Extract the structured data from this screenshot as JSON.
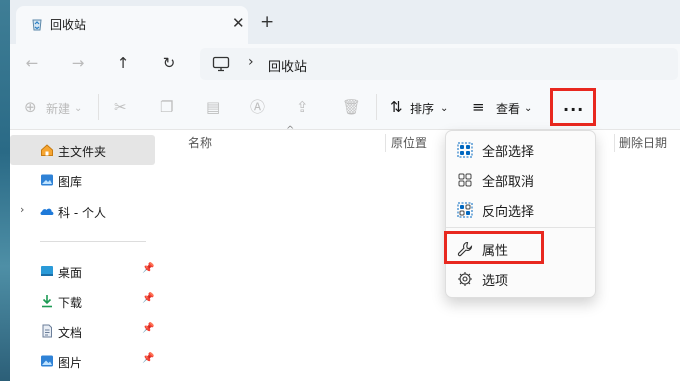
{
  "window": {
    "tab_title": "回收站",
    "tab_close": "✕",
    "new_tab": "+"
  },
  "nav": {
    "back": "←",
    "forward": "→",
    "up": "↑",
    "refresh": "↻"
  },
  "address": {
    "separator": "›",
    "location": "回收站"
  },
  "toolbar": {
    "new_label": "新建",
    "sort_label": "排序",
    "view_label": "查看",
    "more_label": "···"
  },
  "sidebar": {
    "items": [
      {
        "label": "主文件夹",
        "icon": "home-icon"
      },
      {
        "label": "图库",
        "icon": "gallery-icon"
      },
      {
        "label": "科 - 个人",
        "icon": "onedrive-icon"
      },
      {
        "label": "桌面",
        "icon": "desktop-icon"
      },
      {
        "label": "下载",
        "icon": "download-icon"
      },
      {
        "label": "文档",
        "icon": "document-icon"
      },
      {
        "label": "图片",
        "icon": "pictures-icon"
      }
    ],
    "pin_glyph": "📌",
    "expand_glyph": "›"
  },
  "columns": {
    "name": "名称",
    "original_location": "原位置",
    "date_deleted": "删除日期",
    "sort_indicator": "^"
  },
  "menu": {
    "items": [
      {
        "label": "全部选择",
        "icon": "select-all-icon"
      },
      {
        "label": "全部取消",
        "icon": "select-none-icon"
      },
      {
        "label": "反向选择",
        "icon": "invert-selection-icon"
      },
      {
        "label": "属性",
        "icon": "wrench-icon"
      },
      {
        "label": "选项",
        "icon": "gear-icon"
      }
    ]
  },
  "colors": {
    "highlight": "#e8281f",
    "accent": "#0067c0"
  }
}
